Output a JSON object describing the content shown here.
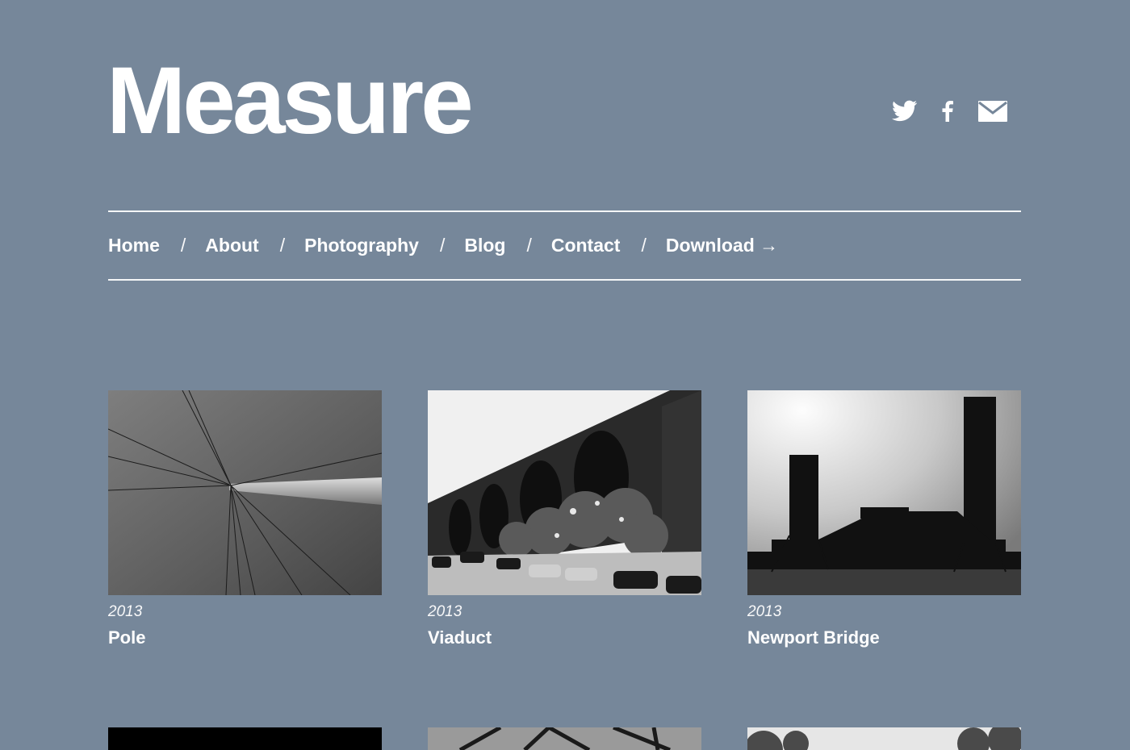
{
  "site": {
    "title": "Measure"
  },
  "social": [
    {
      "name": "twitter-icon"
    },
    {
      "name": "facebook-icon"
    },
    {
      "name": "mail-icon"
    }
  ],
  "nav": {
    "separator": "/",
    "items": [
      "Home",
      "About",
      "Photography",
      "Blog",
      "Contact",
      "Download →"
    ]
  },
  "gallery": [
    {
      "year": "2013",
      "title": "Pole"
    },
    {
      "year": "2013",
      "title": "Viaduct"
    },
    {
      "year": "2013",
      "title": "Newport Bridge"
    }
  ],
  "colors": {
    "background": "#76879a",
    "text": "#ffffff"
  }
}
